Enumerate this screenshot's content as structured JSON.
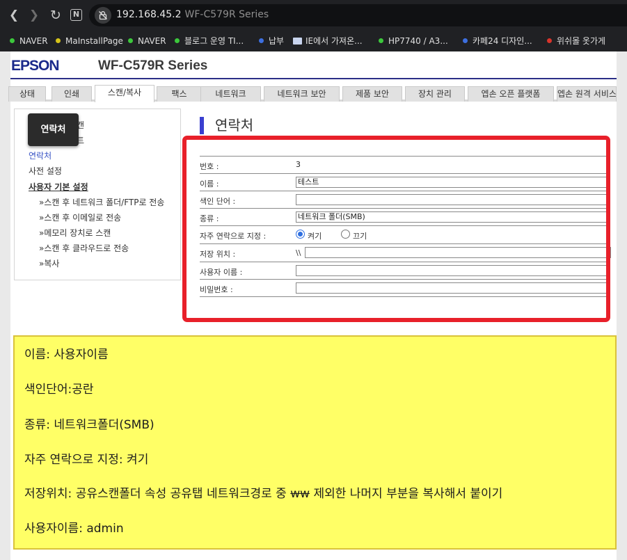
{
  "browser": {
    "url_host": "192.168.45.2",
    "tab_title": "WF-C579R Series",
    "bookmarks": [
      {
        "label": "NAVER",
        "color": "#3cc83c"
      },
      {
        "label": "MaInstallPage",
        "color": "#d6c41a"
      },
      {
        "label": "NAVER",
        "color": "#3cc83c"
      },
      {
        "label": "블로그 운영 TI...",
        "color": "#3cc83c"
      },
      {
        "label": "납부",
        "color": "#3d6fe0"
      },
      {
        "label": "IE에서 가져온...",
        "color": "folder"
      },
      {
        "label": "HP7740 / A3...",
        "color": "#3cc83c"
      },
      {
        "label": "카페24 디자인...",
        "color": "#3d6fe0"
      },
      {
        "label": "위쉬몰 옷가게",
        "color": "#d9342b"
      }
    ]
  },
  "header": {
    "logo": "EPSON",
    "model": "WF-C579R Series"
  },
  "tabs": [
    {
      "label": "상태"
    },
    {
      "label": "인쇄"
    },
    {
      "label": "스캔/복사",
      "active": true
    },
    {
      "label": "팩스"
    },
    {
      "label": "네트워크"
    },
    {
      "label": "네트워크 보안"
    },
    {
      "label": "제품 보안"
    },
    {
      "label": "장치 관리"
    },
    {
      "label": "엡손 오픈 플랫폼"
    },
    {
      "label": "엡손 원격 서비스"
    }
  ],
  "leftmenu": {
    "hidden_1": "캔",
    "hidden_2": "트",
    "contacts": "연락처",
    "presets": "사전 설정",
    "user_defaults": "사용자 기본 설정",
    "subitems": [
      "»스캔 후 네트워크 폴더/FTP로 전송",
      "»스캔 후 이메일로 전송",
      "»메모리 장치로 스캔",
      "»스캔 후 클라우드로 전송",
      "»복사"
    ],
    "tooltip": "연락처"
  },
  "main": {
    "heading": "연락처",
    "form": {
      "number_label": "번호 :",
      "number_value": "3",
      "name_label": "이름 :",
      "name_value": "테스트",
      "index_label": "색인 단어 :",
      "index_value": "",
      "type_label": "종류 :",
      "type_value": "네트워크 폴더(SMB)",
      "freq_label": "자주 연락으로 지정 :",
      "freq_on": "켜기",
      "freq_off": "끄기",
      "freq_selected": "on",
      "path_label": "저장 위치 :",
      "path_prefix": "\\\\",
      "path_value": "",
      "user_label": "사용자 이름 :",
      "user_value": "",
      "pass_label": "비밀번호 :",
      "pass_value": ""
    }
  },
  "note": {
    "line1": "이름: 사용자이름",
    "line2": "색인단어:공란",
    "line3": "종류: 네트워크폴더(SMB)",
    "line4": "자주 연락으로 지정: 켜기",
    "line5_a": "저장위치: 공유스캔폴더 속성 공유탭 네트워크경로 중 ",
    "line5_strike": "ww",
    "line5_b": "  제외한 나머지 부분을 복사해서 붙이기",
    "line6": "사용자이름: admin"
  }
}
